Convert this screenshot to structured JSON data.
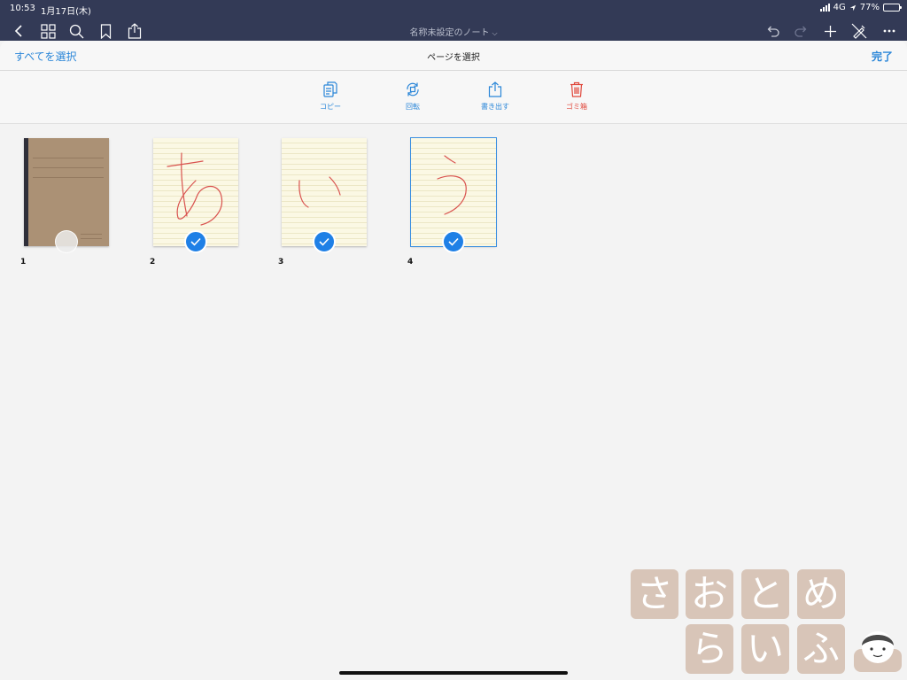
{
  "status_bar": {
    "time": "10:53",
    "date": "1月17日(木)",
    "network": "4G",
    "battery": "77%",
    "battery_level": 0.77
  },
  "toolbar": {
    "icons": [
      "back-icon",
      "grid-icon",
      "search-icon",
      "bookmark-icon",
      "share-icon",
      "undo-icon",
      "redo-icon",
      "add-icon",
      "tools-off-icon",
      "more-icon"
    ],
    "document_title": "名称未設定のノート",
    "title_chevron": "⌵"
  },
  "sheet": {
    "select_all": "すべてを選択",
    "title": "ページを選択",
    "done": "完了"
  },
  "actions": [
    {
      "label": "コピー",
      "icon": "copy-icon",
      "color": "#2a86d8"
    },
    {
      "label": "回転",
      "icon": "rotate-icon",
      "color": "#2a86d8"
    },
    {
      "label": "書き出す",
      "icon": "export-icon",
      "color": "#2a86d8"
    },
    {
      "label": "ゴミ箱",
      "icon": "trash-icon",
      "color": "#e0463a"
    }
  ],
  "pages": [
    {
      "number": "1",
      "type": "cover",
      "selected": false
    },
    {
      "number": "2",
      "type": "lined",
      "handwriting": "あ",
      "selected": true
    },
    {
      "number": "3",
      "type": "lined",
      "handwriting": "い",
      "selected": true
    },
    {
      "number": "4",
      "type": "lined",
      "handwriting": "う",
      "selected": true,
      "current": true
    }
  ],
  "watermark": {
    "row1": [
      "さ",
      "お",
      "と",
      "め"
    ],
    "row2": [
      "ら",
      "い",
      "ふ"
    ]
  },
  "colors": {
    "accent": "#2a86d8",
    "danger": "#e0463a",
    "appbar": "#333a56",
    "ink": "#d9534f"
  }
}
